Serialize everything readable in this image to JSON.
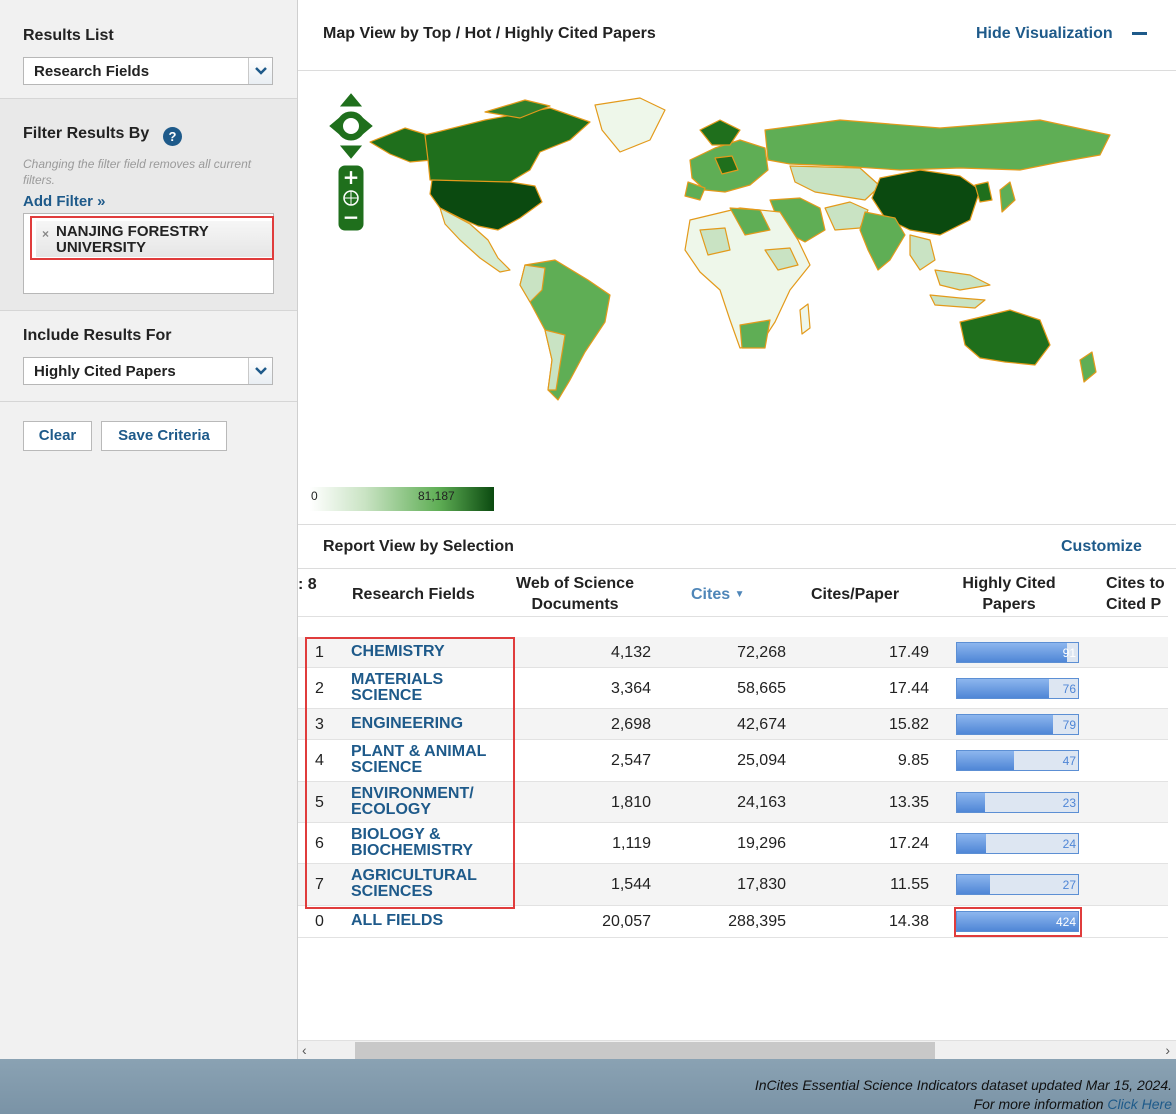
{
  "sidebar": {
    "results_list": {
      "title": "Results List",
      "selected": "Research Fields"
    },
    "filter": {
      "title": "Filter Results By",
      "help": "?",
      "note": "Changing the filter field removes all current filters.",
      "add_filter": "Add Filter »",
      "active_filter": "NANJING FORESTRY UNIVERSITY",
      "remove_symbol": "×"
    },
    "include": {
      "title": "Include Results For",
      "selected": "Highly Cited Papers"
    },
    "buttons": {
      "clear": "Clear",
      "save": "Save Criteria"
    }
  },
  "map": {
    "title": "Map View by Top / Hot / Highly Cited Papers",
    "hide": "Hide Visualization",
    "hide_icon": "minus-icon",
    "legend_min": "0",
    "legend_max": "81,187",
    "colors": {
      "lightest": "#f4faf2",
      "light": "#c9e3c3",
      "medium": "#5fae55",
      "dark": "#1f6f1c",
      "darkest": "#0b4a10",
      "border": "#e39a1b"
    }
  },
  "report": {
    "title": "Report View by Selection",
    "customize": "Customize",
    "columns": {
      "rank": ": 8",
      "field": "Research Fields",
      "docs": "Web of Science Documents",
      "cites": "Cites",
      "cites_sort_icon": "sort-desc-icon",
      "cpp": "Cites/Paper",
      "hcp": "Highly Cited Papers",
      "cites_top": "Cites to Cited P"
    },
    "rows": [
      {
        "rank": "1",
        "field": "CHEMISTRY",
        "docs": "4,132",
        "cites": "72,268",
        "cpp": "17.49",
        "hcp": 91
      },
      {
        "rank": "2",
        "field": "MATERIALS SCIENCE",
        "docs": "3,364",
        "cites": "58,665",
        "cpp": "17.44",
        "hcp": 76
      },
      {
        "rank": "3",
        "field": "ENGINEERING",
        "docs": "2,698",
        "cites": "42,674",
        "cpp": "15.82",
        "hcp": 79
      },
      {
        "rank": "4",
        "field": "PLANT & ANIMAL SCIENCE",
        "docs": "2,547",
        "cites": "25,094",
        "cpp": "9.85",
        "hcp": 47
      },
      {
        "rank": "5",
        "field": "ENVIRONMENT/ ECOLOGY",
        "docs": "1,810",
        "cites": "24,163",
        "cpp": "13.35",
        "hcp": 23
      },
      {
        "rank": "6",
        "field": "BIOLOGY & BIOCHEMISTRY",
        "docs": "1,119",
        "cites": "19,296",
        "cpp": "17.24",
        "hcp": 24
      },
      {
        "rank": "7",
        "field": "AGRICULTURAL SCIENCES",
        "docs": "1,544",
        "cites": "17,830",
        "cpp": "11.55",
        "hcp": 27
      },
      {
        "rank": "0",
        "field": "ALL FIELDS",
        "docs": "20,057",
        "cites": "288,395",
        "cpp": "14.38",
        "hcp": 424
      }
    ]
  },
  "footer": {
    "line1": "InCites Essential Science Indicators dataset updated Mar 15, 2024.",
    "line2_prefix": "For more information ",
    "line2_link": "Click Here"
  }
}
